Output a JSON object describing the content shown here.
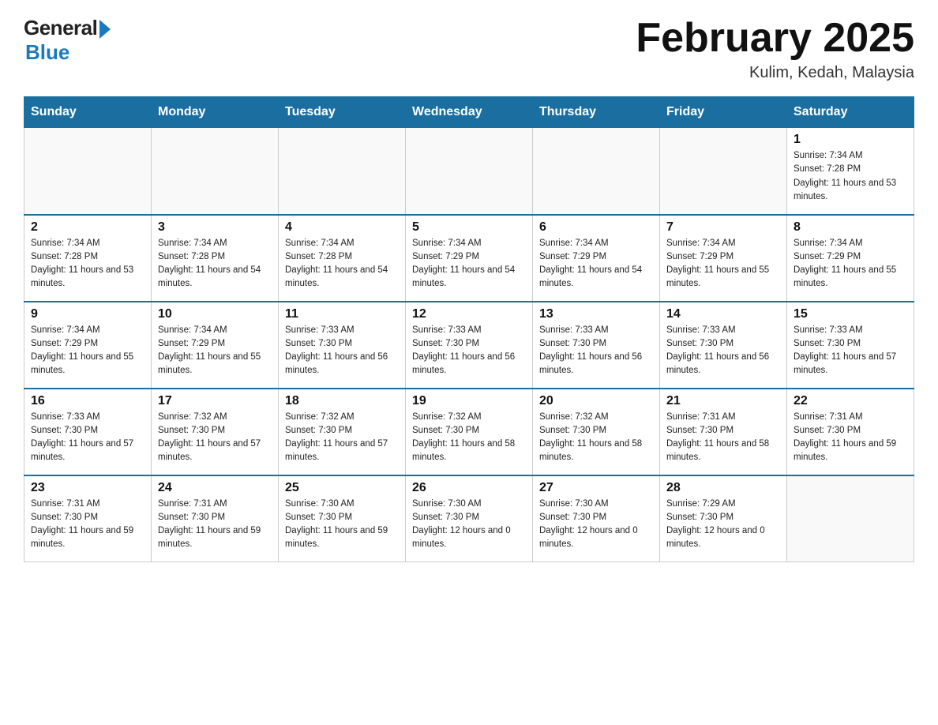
{
  "header": {
    "logo_general": "General",
    "logo_blue": "Blue",
    "title": "February 2025",
    "subtitle": "Kulim, Kedah, Malaysia"
  },
  "days_of_week": [
    "Sunday",
    "Monday",
    "Tuesday",
    "Wednesday",
    "Thursday",
    "Friday",
    "Saturday"
  ],
  "weeks": [
    [
      {
        "day": "",
        "sunrise": "",
        "sunset": "",
        "daylight": ""
      },
      {
        "day": "",
        "sunrise": "",
        "sunset": "",
        "daylight": ""
      },
      {
        "day": "",
        "sunrise": "",
        "sunset": "",
        "daylight": ""
      },
      {
        "day": "",
        "sunrise": "",
        "sunset": "",
        "daylight": ""
      },
      {
        "day": "",
        "sunrise": "",
        "sunset": "",
        "daylight": ""
      },
      {
        "day": "",
        "sunrise": "",
        "sunset": "",
        "daylight": ""
      },
      {
        "day": "1",
        "sunrise": "Sunrise: 7:34 AM",
        "sunset": "Sunset: 7:28 PM",
        "daylight": "Daylight: 11 hours and 53 minutes."
      }
    ],
    [
      {
        "day": "2",
        "sunrise": "Sunrise: 7:34 AM",
        "sunset": "Sunset: 7:28 PM",
        "daylight": "Daylight: 11 hours and 53 minutes."
      },
      {
        "day": "3",
        "sunrise": "Sunrise: 7:34 AM",
        "sunset": "Sunset: 7:28 PM",
        "daylight": "Daylight: 11 hours and 54 minutes."
      },
      {
        "day": "4",
        "sunrise": "Sunrise: 7:34 AM",
        "sunset": "Sunset: 7:28 PM",
        "daylight": "Daylight: 11 hours and 54 minutes."
      },
      {
        "day": "5",
        "sunrise": "Sunrise: 7:34 AM",
        "sunset": "Sunset: 7:29 PM",
        "daylight": "Daylight: 11 hours and 54 minutes."
      },
      {
        "day": "6",
        "sunrise": "Sunrise: 7:34 AM",
        "sunset": "Sunset: 7:29 PM",
        "daylight": "Daylight: 11 hours and 54 minutes."
      },
      {
        "day": "7",
        "sunrise": "Sunrise: 7:34 AM",
        "sunset": "Sunset: 7:29 PM",
        "daylight": "Daylight: 11 hours and 55 minutes."
      },
      {
        "day": "8",
        "sunrise": "Sunrise: 7:34 AM",
        "sunset": "Sunset: 7:29 PM",
        "daylight": "Daylight: 11 hours and 55 minutes."
      }
    ],
    [
      {
        "day": "9",
        "sunrise": "Sunrise: 7:34 AM",
        "sunset": "Sunset: 7:29 PM",
        "daylight": "Daylight: 11 hours and 55 minutes."
      },
      {
        "day": "10",
        "sunrise": "Sunrise: 7:34 AM",
        "sunset": "Sunset: 7:29 PM",
        "daylight": "Daylight: 11 hours and 55 minutes."
      },
      {
        "day": "11",
        "sunrise": "Sunrise: 7:33 AM",
        "sunset": "Sunset: 7:30 PM",
        "daylight": "Daylight: 11 hours and 56 minutes."
      },
      {
        "day": "12",
        "sunrise": "Sunrise: 7:33 AM",
        "sunset": "Sunset: 7:30 PM",
        "daylight": "Daylight: 11 hours and 56 minutes."
      },
      {
        "day": "13",
        "sunrise": "Sunrise: 7:33 AM",
        "sunset": "Sunset: 7:30 PM",
        "daylight": "Daylight: 11 hours and 56 minutes."
      },
      {
        "day": "14",
        "sunrise": "Sunrise: 7:33 AM",
        "sunset": "Sunset: 7:30 PM",
        "daylight": "Daylight: 11 hours and 56 minutes."
      },
      {
        "day": "15",
        "sunrise": "Sunrise: 7:33 AM",
        "sunset": "Sunset: 7:30 PM",
        "daylight": "Daylight: 11 hours and 57 minutes."
      }
    ],
    [
      {
        "day": "16",
        "sunrise": "Sunrise: 7:33 AM",
        "sunset": "Sunset: 7:30 PM",
        "daylight": "Daylight: 11 hours and 57 minutes."
      },
      {
        "day": "17",
        "sunrise": "Sunrise: 7:32 AM",
        "sunset": "Sunset: 7:30 PM",
        "daylight": "Daylight: 11 hours and 57 minutes."
      },
      {
        "day": "18",
        "sunrise": "Sunrise: 7:32 AM",
        "sunset": "Sunset: 7:30 PM",
        "daylight": "Daylight: 11 hours and 57 minutes."
      },
      {
        "day": "19",
        "sunrise": "Sunrise: 7:32 AM",
        "sunset": "Sunset: 7:30 PM",
        "daylight": "Daylight: 11 hours and 58 minutes."
      },
      {
        "day": "20",
        "sunrise": "Sunrise: 7:32 AM",
        "sunset": "Sunset: 7:30 PM",
        "daylight": "Daylight: 11 hours and 58 minutes."
      },
      {
        "day": "21",
        "sunrise": "Sunrise: 7:31 AM",
        "sunset": "Sunset: 7:30 PM",
        "daylight": "Daylight: 11 hours and 58 minutes."
      },
      {
        "day": "22",
        "sunrise": "Sunrise: 7:31 AM",
        "sunset": "Sunset: 7:30 PM",
        "daylight": "Daylight: 11 hours and 59 minutes."
      }
    ],
    [
      {
        "day": "23",
        "sunrise": "Sunrise: 7:31 AM",
        "sunset": "Sunset: 7:30 PM",
        "daylight": "Daylight: 11 hours and 59 minutes."
      },
      {
        "day": "24",
        "sunrise": "Sunrise: 7:31 AM",
        "sunset": "Sunset: 7:30 PM",
        "daylight": "Daylight: 11 hours and 59 minutes."
      },
      {
        "day": "25",
        "sunrise": "Sunrise: 7:30 AM",
        "sunset": "Sunset: 7:30 PM",
        "daylight": "Daylight: 11 hours and 59 minutes."
      },
      {
        "day": "26",
        "sunrise": "Sunrise: 7:30 AM",
        "sunset": "Sunset: 7:30 PM",
        "daylight": "Daylight: 12 hours and 0 minutes."
      },
      {
        "day": "27",
        "sunrise": "Sunrise: 7:30 AM",
        "sunset": "Sunset: 7:30 PM",
        "daylight": "Daylight: 12 hours and 0 minutes."
      },
      {
        "day": "28",
        "sunrise": "Sunrise: 7:29 AM",
        "sunset": "Sunset: 7:30 PM",
        "daylight": "Daylight: 12 hours and 0 minutes."
      },
      {
        "day": "",
        "sunrise": "",
        "sunset": "",
        "daylight": ""
      }
    ]
  ]
}
